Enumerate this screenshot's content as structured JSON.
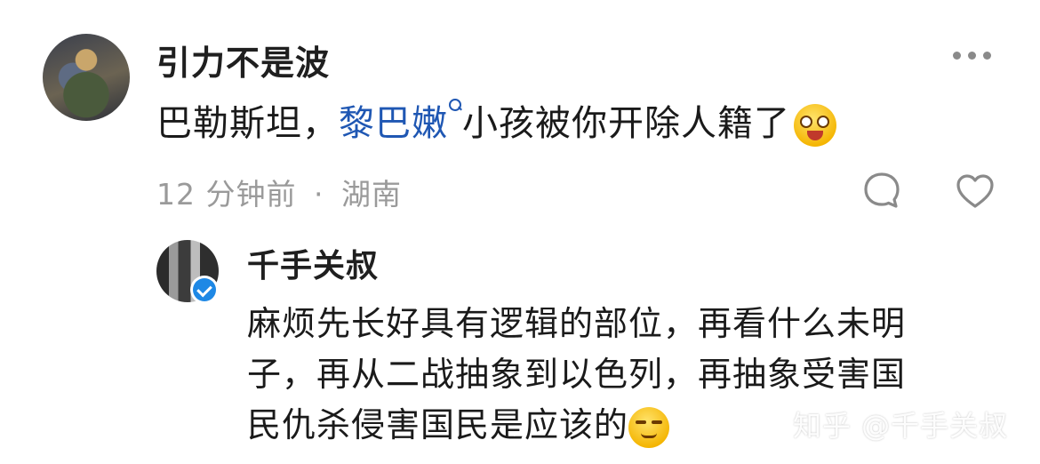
{
  "main_comment": {
    "username": "引力不是波",
    "text_before": "巴勒斯坦，",
    "link_text": "黎巴嫩",
    "text_after": "小孩被你开除人籍了",
    "emoji": "drooling-face-emoji",
    "time": "12 分钟前",
    "separator": "·",
    "location": "湖南"
  },
  "reply": {
    "username": "千手关叔",
    "verified": true,
    "lines": [
      "麻烦先长好具有逻辑的部位，再看什么未明",
      "子，再从二战抽象到以色列，再抽象受害国",
      "民仇杀侵害国民是应该的"
    ],
    "emoji": "smirk-face-emoji"
  },
  "icons": {
    "more": "more-icon",
    "reply": "reply-bubble-icon",
    "like": "heart-icon"
  },
  "watermark": "知乎 @千手关叔"
}
